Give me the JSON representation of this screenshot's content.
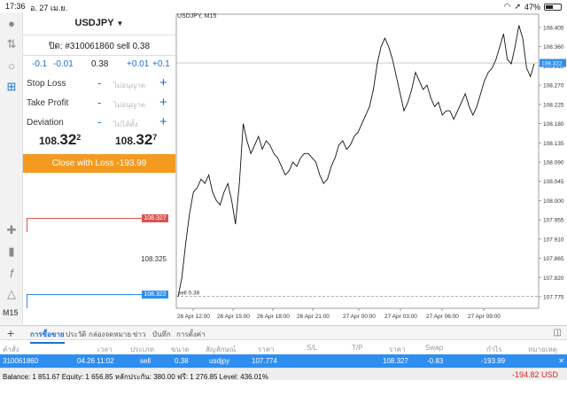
{
  "status": {
    "time": "17:36",
    "date": "อ. 27 เม.ย.",
    "battery": "47%",
    "battery_level": 0.47
  },
  "order": {
    "symbol": "USDJPY",
    "position": "ปิด: #310061860 sell 0.38",
    "steps": [
      "-0.1",
      "-0.01",
      "0.38",
      "+0.01",
      "+0.1"
    ],
    "stop_loss": {
      "label": "Stop Loss",
      "value": "ไม่อนุญาต"
    },
    "take_profit": {
      "label": "Take Profit",
      "value": "ไม่อนุญาต"
    },
    "deviation": {
      "label": "Deviation",
      "value": "ไม่ได้ตั้ง"
    },
    "bid": {
      "prefix": "108.",
      "big": "32",
      "sup": "2"
    },
    "ask": {
      "prefix": "108.",
      "big": "32",
      "sup": "7"
    },
    "close_button": "Close with Loss -193.99",
    "depth": {
      "ask_tag": "108.327",
      "mid": "108.325",
      "bid_tag": "108.322"
    },
    "timeframe": "M15"
  },
  "chart_data": {
    "type": "line",
    "title": "USDJPY, M15",
    "x_labels": [
      "26 Apr 12:00",
      "26 Apr 15:00",
      "26 Apr 18:00",
      "26 Apr 21:00",
      "27 Apr 00:00",
      "27 Apr 03:00",
      "27 Apr 06:00",
      "27 Apr 09:00"
    ],
    "y_ticks": [
      "108.405",
      "108.360",
      "108.315",
      "108.270",
      "108.225",
      "108.180",
      "108.135",
      "108.090",
      "108.045",
      "108.000",
      "107.955",
      "107.910",
      "107.865",
      "107.820",
      "107.775"
    ],
    "ylim": [
      107.775,
      108.405
    ],
    "current_price": "108.322",
    "position_line": {
      "label": "sell 0.38",
      "price": 107.774
    },
    "values": [
      107.775,
      107.82,
      107.9,
      107.97,
      108.02,
      108.03,
      108.05,
      108.04,
      108.06,
      108.02,
      108.0,
      107.99,
      108.02,
      108.04,
      108.0,
      107.945,
      108.04,
      108.18,
      108.14,
      108.11,
      108.13,
      108.15,
      108.12,
      108.14,
      108.13,
      108.11,
      108.1,
      108.08,
      108.06,
      108.07,
      108.09,
      108.08,
      108.1,
      108.11,
      108.11,
      108.1,
      108.09,
      108.06,
      108.04,
      108.05,
      108.08,
      108.1,
      108.13,
      108.14,
      108.12,
      108.13,
      108.15,
      108.16,
      108.18,
      108.2,
      108.22,
      108.26,
      108.32,
      108.36,
      108.38,
      108.36,
      108.33,
      108.29,
      108.25,
      108.21,
      108.23,
      108.26,
      108.3,
      108.28,
      108.26,
      108.27,
      108.24,
      108.22,
      108.23,
      108.2,
      108.21,
      108.21,
      108.19,
      108.21,
      108.23,
      108.25,
      108.22,
      108.2,
      108.22,
      108.25,
      108.28,
      108.3,
      108.31,
      108.33,
      108.36,
      108.39,
      108.33,
      108.32,
      108.36,
      108.41,
      108.38,
      108.31,
      108.29,
      108.32
    ]
  },
  "tabs": [
    "การซื้อขาย",
    "ประวัติ",
    "กล่องจดหมาย",
    "ข่าว",
    "บันทึก",
    "การตั้งค่า"
  ],
  "table": {
    "headers": [
      "คำสั่ง",
      "เวลา",
      "ประเภท",
      "ขนาด",
      "สัญลักษณ์",
      "ราคา",
      "S/L",
      "T/P",
      "ราคา",
      "Swap",
      "กำไร",
      "หมายเหตุ"
    ],
    "row": [
      "310061860",
      "04.26 11:02",
      "sell",
      "0.38",
      "usdjpy",
      "107.774",
      "",
      "",
      "108.327",
      "-0.83",
      "-193.99",
      ""
    ]
  },
  "balance": {
    "text": "Balance: 1 851.67 Equity: 1 656.85 หลักประกัน: 380.00 ฟรี: 1 276.85 Level: 436.01%",
    "pl": "-194.82  USD"
  },
  "colors": {
    "accent": "#1a6fd6",
    "orange": "#f39a1f",
    "ask": "#d9534f",
    "bid": "#2e8ef0",
    "loss": "#d2232a"
  }
}
